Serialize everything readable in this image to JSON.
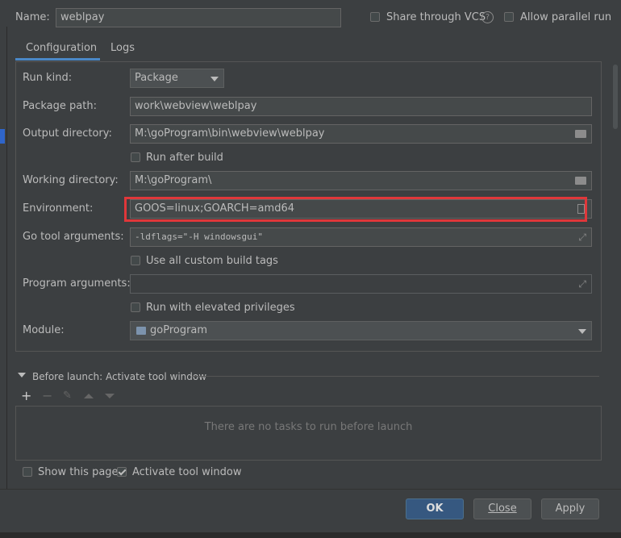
{
  "header": {
    "name_label": "Name:",
    "name_value": "weblpay",
    "share_vcs_label": "Share through VCS",
    "allow_parallel_label": "Allow parallel run"
  },
  "tabs": [
    {
      "label": "Configuration",
      "active": true
    },
    {
      "label": "Logs",
      "active": false
    }
  ],
  "form": {
    "run_kind": {
      "label": "Run kind:",
      "value": "Package"
    },
    "package_path": {
      "label": "Package path:",
      "value": "work\\webview\\weblpay"
    },
    "output_directory": {
      "label": "Output directory:",
      "value": "M:\\goProgram\\bin\\webview\\weblpay"
    },
    "run_after_build": {
      "label": "Run after build",
      "checked": false
    },
    "working_directory": {
      "label": "Working directory:",
      "value": "M:\\goProgram\\"
    },
    "environment": {
      "label": "Environment:",
      "value": "GOOS=linux;GOARCH=amd64"
    },
    "go_tool_arguments": {
      "label": "Go tool arguments:",
      "value": "-ldflags=\"-H windowsgui\""
    },
    "use_custom_build_tags": {
      "label": "Use all custom build tags",
      "checked": false
    },
    "program_arguments": {
      "label": "Program arguments:",
      "value": ""
    },
    "run_elevated": {
      "label": "Run with elevated privileges",
      "checked": false
    },
    "module": {
      "label": "Module:",
      "value": "goProgram"
    }
  },
  "before_launch": {
    "title": "Before launch: Activate tool window",
    "empty_text": "There are no tasks to run before launch"
  },
  "footer": {
    "show_page_label": "Show this page",
    "show_page_checked": false,
    "activate_tool_label": "Activate tool window",
    "activate_tool_checked": true,
    "ok_label": "OK",
    "close_label": "Close",
    "apply_label": "Apply"
  },
  "colors": {
    "background": "#3c3f41",
    "highlight_border": "#e0373a",
    "primary_button": "#365880"
  }
}
